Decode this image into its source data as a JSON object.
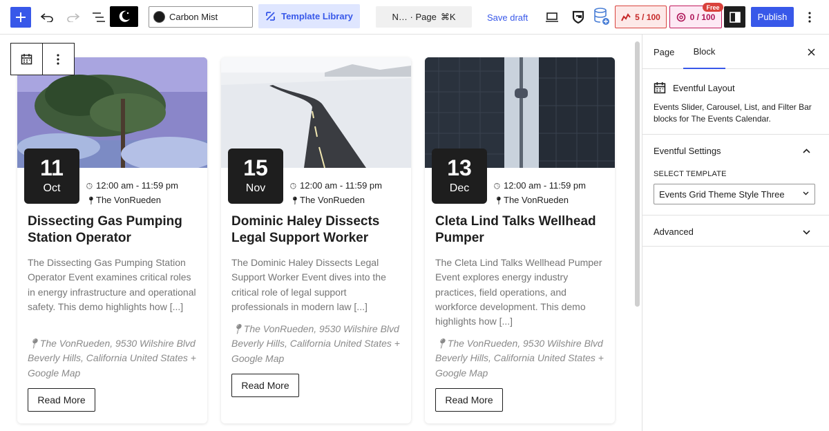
{
  "topbar": {
    "theme_name": "Carbon Mist",
    "template_library": "Template Library",
    "command": "N… · Page",
    "command_shortcut": "⌘K",
    "save_draft": "Save draft",
    "score1": "5 / 100",
    "score2": "0 / 100",
    "free_badge": "Free",
    "publish": "Publish",
    "icons": [
      "add-icon",
      "undo-icon",
      "redo-icon",
      "list-view-icon",
      "moon-icon",
      "template-library-icon",
      "desktop-view-icon",
      "plugin-shield-icon",
      "database-icon",
      "seo-score-icon",
      "readability-icon",
      "sidebar-toggle-icon",
      "more-options-icon"
    ]
  },
  "cards": [
    {
      "day": "11",
      "month": "Oct",
      "time": "12:00 am - 11:59 pm",
      "venue": "The VonRueden",
      "title": "Dissecting Gas Pumping Station Operator",
      "description": "The Dissecting Gas Pumping Station Operator Event examines critical roles in energy infrastructure and operational safety. This demo highlights how [...]",
      "address": "The VonRueden, 9530 Wilshire Blvd Beverly Hills, California United States + Google Map",
      "read_more": "Read More"
    },
    {
      "day": "15",
      "month": "Nov",
      "time": "12:00 am - 11:59 pm",
      "venue": "The VonRueden",
      "title": "Dominic Haley Dissects Legal Support Worker",
      "description": "The Dominic Haley Dissects Legal Support Worker Event dives into the critical role of legal support professionals in modern law [...]",
      "address": "The VonRueden, 9530 Wilshire Blvd Beverly Hills, California United States + Google Map",
      "read_more": "Read More"
    },
    {
      "day": "13",
      "month": "Dec",
      "time": "12:00 am - 11:59 pm",
      "venue": "The VonRueden",
      "title": "Cleta Lind Talks Wellhead Pumper",
      "description": "The Cleta Lind Talks Wellhead Pumper Event explores energy industry practices, field operations, and workforce development. This demo highlights how [...]",
      "address": "The VonRueden, 9530 Wilshire Blvd Beverly Hills, California United States + Google Map",
      "read_more": "Read More"
    }
  ],
  "panel": {
    "tab_page": "Page",
    "tab_block": "Block",
    "block_name": "Eventful Layout",
    "block_description": "Events Slider, Carousel, List, and Filter Bar blocks for The Events Calendar.",
    "settings_title": "Eventful Settings",
    "select_label": "SELECT TEMPLATE",
    "select_value": "Events Grid Theme Style Three",
    "advanced_title": "Advanced"
  },
  "colors": {
    "accent": "#3858e9",
    "date_box": "#1e1e1e",
    "score1": "#c62828",
    "score2": "#ad1457"
  }
}
